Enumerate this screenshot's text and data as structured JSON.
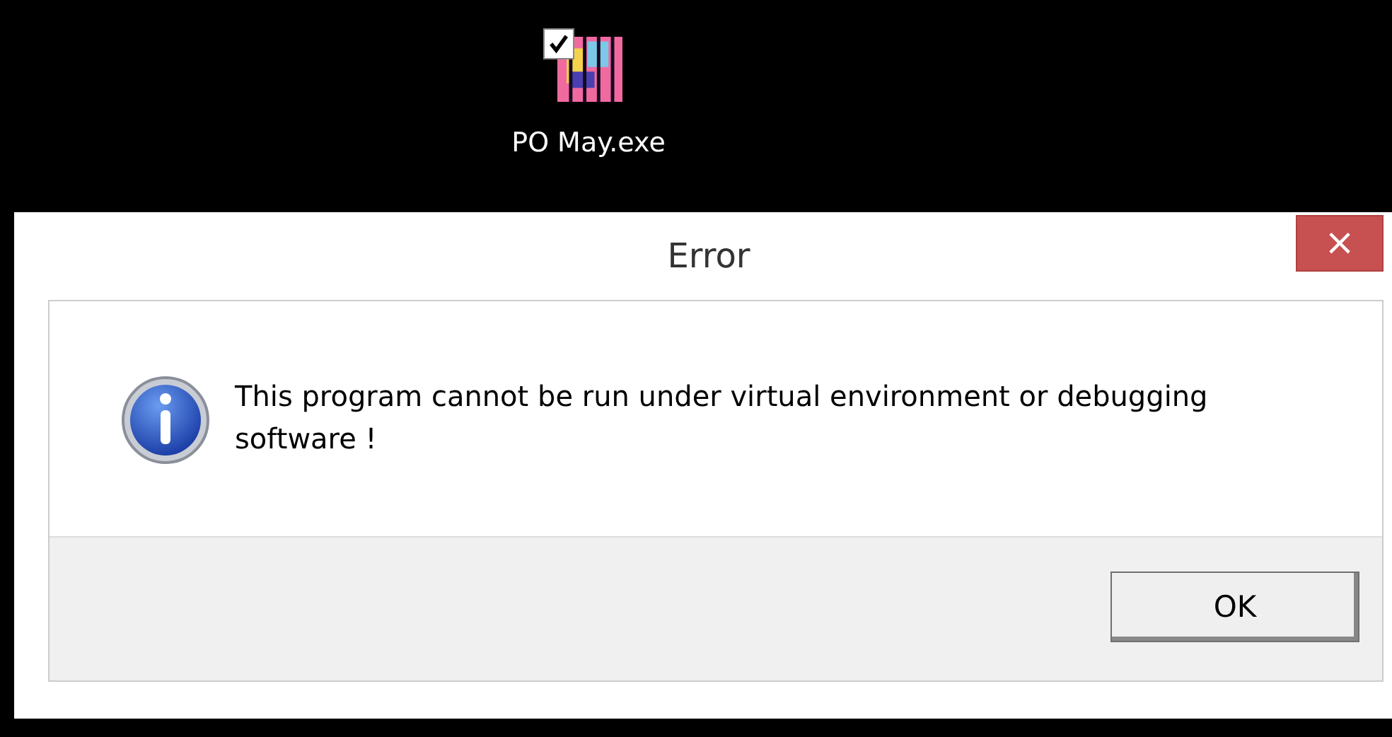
{
  "desktop_icon": {
    "label": "PO May.exe",
    "checked": true
  },
  "dialog": {
    "title": "Error",
    "close": "×",
    "message": "This program cannot be run under virtual environment or debugging software !",
    "buttons": [
      "OK"
    ]
  }
}
